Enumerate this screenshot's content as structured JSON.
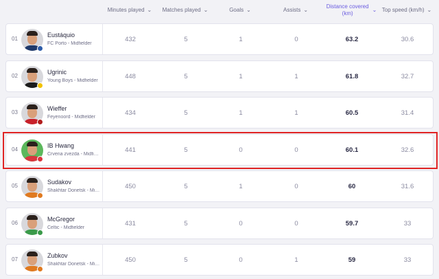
{
  "headers": [
    {
      "label": "Minutes played",
      "active": false
    },
    {
      "label": "Matches played",
      "active": false
    },
    {
      "label": "Goals",
      "active": false
    },
    {
      "label": "Assists",
      "active": false
    },
    {
      "label": "Distance covered (km)",
      "active": true
    },
    {
      "label": "Top speed (km/h)",
      "active": false
    }
  ],
  "accent_color": "#6a5ce0",
  "highlight_color": "#e02424",
  "rows": [
    {
      "rank": "01",
      "name": "Eustáquio",
      "team": "FC Porto - Midfielder",
      "minutes": "432",
      "matches": "5",
      "goals": "1",
      "assists": "0",
      "distance": "63.2",
      "speed": "30.6",
      "avatar_bg": "#d8d8dc",
      "shirt": "#1f3a6b",
      "badge": "#2d5ca8"
    },
    {
      "rank": "02",
      "name": "Ugrinic",
      "team": "Young Boys - Midfielder",
      "minutes": "448",
      "matches": "5",
      "goals": "1",
      "assists": "1",
      "distance": "61.8",
      "speed": "32.7",
      "avatar_bg": "#d8d8dc",
      "shirt": "#1c1c1c",
      "badge": "#f2c200"
    },
    {
      "rank": "03",
      "name": "Wieffer",
      "team": "Feyenoord - Midfielder",
      "minutes": "434",
      "matches": "5",
      "goals": "1",
      "assists": "1",
      "distance": "60.5",
      "speed": "31.4",
      "avatar_bg": "#d8d8dc",
      "shirt": "#c8202a",
      "badge": "#b21e1e"
    },
    {
      "rank": "04",
      "name": "IB Hwang",
      "team": "Crvena zvezda - Midfielder",
      "minutes": "441",
      "matches": "5",
      "goals": "0",
      "assists": "0",
      "distance": "60.1",
      "speed": "32.6",
      "avatar_bg": "#5cb85c",
      "shirt": "#d9363e",
      "badge": "#d9363e"
    },
    {
      "rank": "05",
      "name": "Sudakov",
      "team": "Shakhtar Donetsk - Midfielder",
      "minutes": "450",
      "matches": "5",
      "goals": "1",
      "assists": "0",
      "distance": "60",
      "speed": "31.6",
      "avatar_bg": "#d8d8dc",
      "shirt": "#e07a20",
      "badge": "#e07a20"
    },
    {
      "rank": "06",
      "name": "McGregor",
      "team": "Celtic - Midfielder",
      "minutes": "431",
      "matches": "5",
      "goals": "0",
      "assists": "0",
      "distance": "59.7",
      "speed": "33",
      "avatar_bg": "#d8d8dc",
      "shirt": "#3a9a4a",
      "badge": "#3a9a4a"
    },
    {
      "rank": "07",
      "name": "Zubkov",
      "team": "Shakhtar Donetsk - Midfielder",
      "minutes": "450",
      "matches": "5",
      "goals": "0",
      "assists": "1",
      "distance": "59",
      "speed": "33",
      "avatar_bg": "#d8d8dc",
      "shirt": "#e07a20",
      "badge": "#e07a20"
    }
  ],
  "highlighted_rank": "04"
}
